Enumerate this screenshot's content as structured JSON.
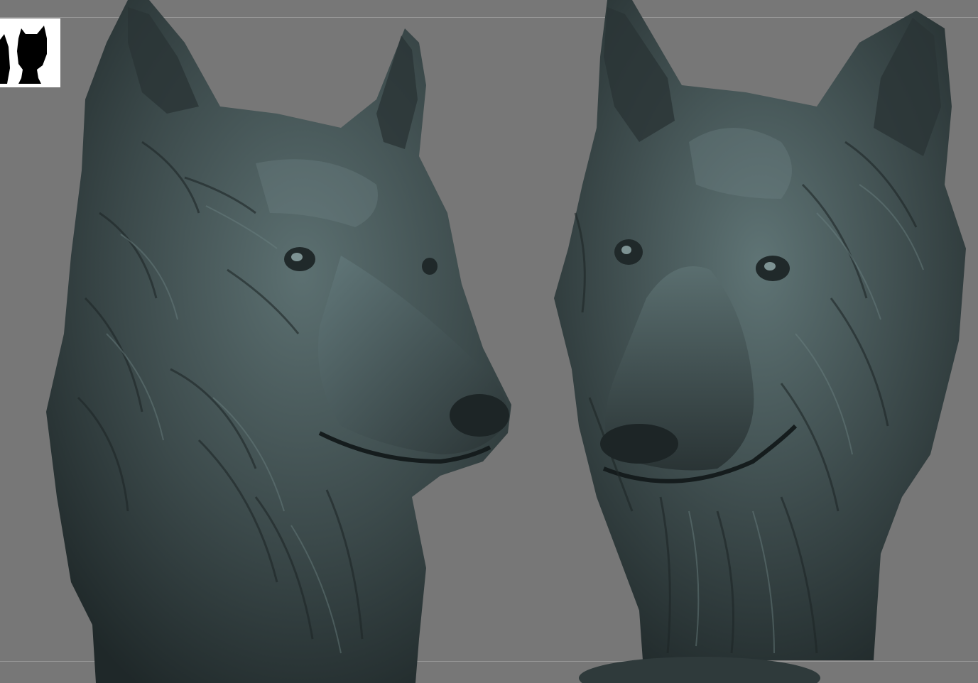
{
  "viewport": {
    "background_color": "#777777",
    "frame_line_color": "#9a9a9a"
  },
  "navigator": {
    "name": "navigator-thumbnail",
    "background_color": "#ffffff",
    "silhouette_color": "#000000"
  },
  "models": [
    {
      "name": "wolf-head-three-quarter-view",
      "material_color": "#3c4a4b",
      "highlight_color": "#6f8586",
      "shadow_color": "#1d2526"
    },
    {
      "name": "wolf-head-front-view",
      "material_color": "#3c4a4b",
      "highlight_color": "#6f8586",
      "shadow_color": "#1d2526"
    }
  ]
}
